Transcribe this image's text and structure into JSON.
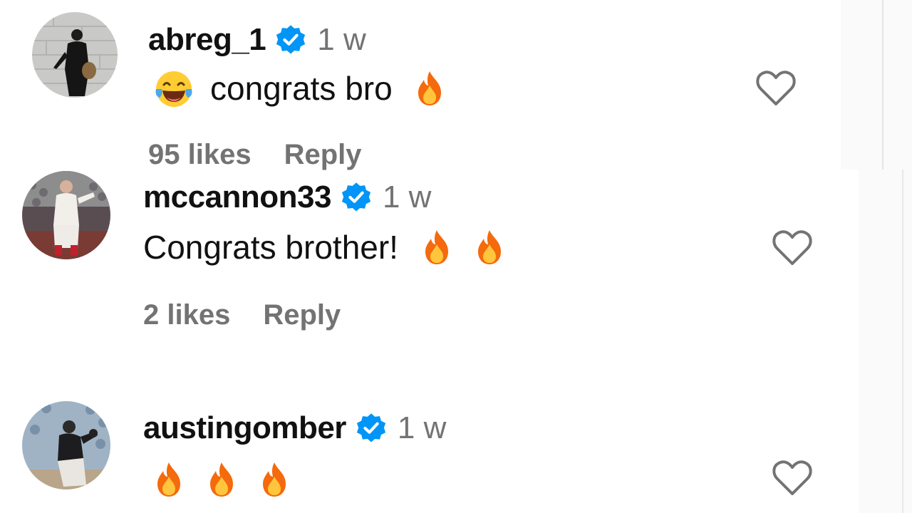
{
  "comments": [
    {
      "username": "abreg_1",
      "time": "1 w",
      "text": "congrats bro",
      "likes": "95 likes",
      "reply": "Reply"
    },
    {
      "username": "mccannon33",
      "time": "1 w",
      "text": "Congrats brother!",
      "likes": "2 likes",
      "reply": "Reply"
    },
    {
      "username": "austingomber",
      "time": "1 w",
      "text": "",
      "likes": "",
      "reply": ""
    }
  ],
  "colors": {
    "verified": "#0095f6",
    "secondary_text": "#737373",
    "fire_outer": "#f46a0c",
    "fire_inner": "#ffc53d"
  },
  "icons": {
    "verified": "verified-badge-icon",
    "like": "heart-outline-icon",
    "laugh_emoji": "face-with-tears-of-joy-emoji",
    "fire_emoji": "fire-emoji"
  }
}
